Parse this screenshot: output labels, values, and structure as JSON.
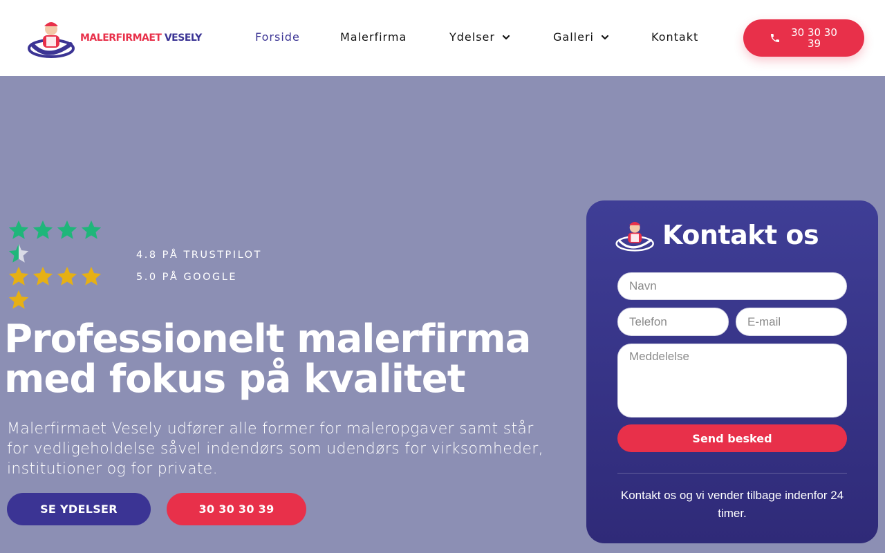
{
  "header": {
    "logo": {
      "name_part1": "MALERFIRMAET",
      "name_part2": " VESELY"
    },
    "nav": [
      {
        "label": "Forside",
        "active": true,
        "has_dropdown": false
      },
      {
        "label": "Malerfirma",
        "active": false,
        "has_dropdown": false
      },
      {
        "label": "Ydelser",
        "active": false,
        "has_dropdown": true
      },
      {
        "label": "Galleri",
        "active": false,
        "has_dropdown": true
      },
      {
        "label": "Kontakt",
        "active": false,
        "has_dropdown": false
      }
    ],
    "phone_button": {
      "label": "30 30 30 39",
      "icon": "phone-icon"
    }
  },
  "hero": {
    "ratings": [
      {
        "text": "4.8 PÅ TRUSTPILOT",
        "stars": 4.5,
        "color": "#1fb67a"
      },
      {
        "text": "5.0 PÅ GOOGLE",
        "stars": 5,
        "color": "#e6b014"
      }
    ],
    "title_line1": "Professionelt malerfirma",
    "title_line2": "med fokus på kvalitet",
    "subtitle": "Malerfirmaet Vesely udfører alle former for maleropgaver samt står for vedligeholdelse såvel indendørs som udendørs for virksomheder, institutioner og for private.",
    "primary_button": "SE YDELSER",
    "secondary_button": "30 30 30 39"
  },
  "contact": {
    "title": "Kontakt os",
    "fields": {
      "name_placeholder": "Navn",
      "phone_placeholder": "Telefon",
      "email_placeholder": "E-mail",
      "message_placeholder": "Meddelelse"
    },
    "submit_label": "Send besked",
    "note": "Kontakt os og vi vender tilbage indenfor 24 timer."
  },
  "colors": {
    "brand_red": "#e8304a",
    "brand_blue": "#3b3494",
    "hero_bg": "#8c8fb4"
  }
}
